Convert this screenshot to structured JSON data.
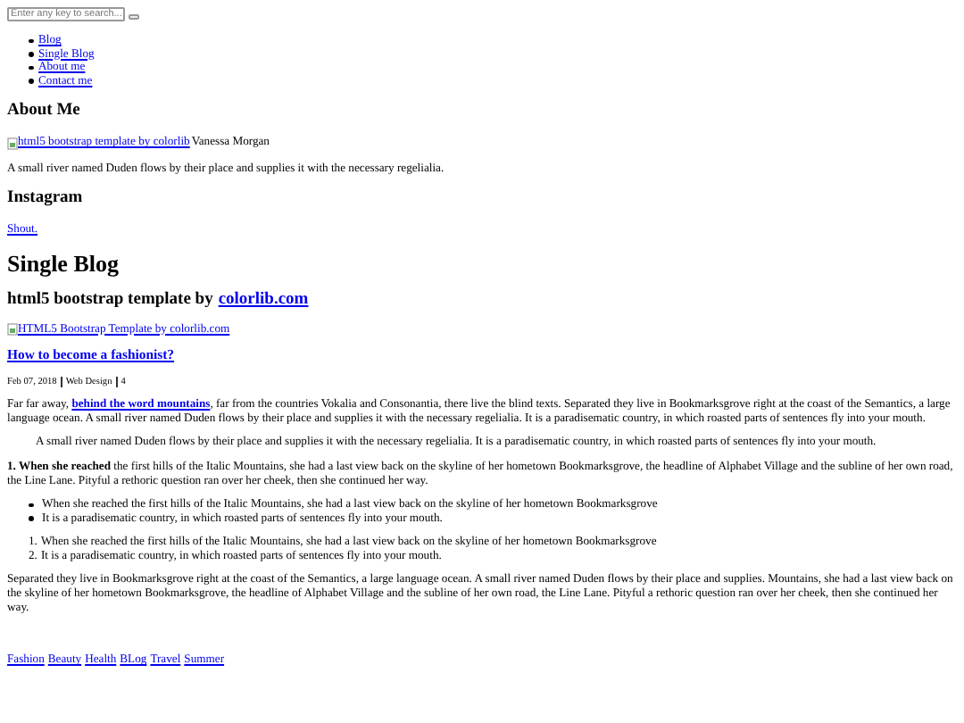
{
  "search": {
    "placeholder": "Enter any key to search..."
  },
  "nav": {
    "items": [
      "Blog",
      "Single Blog",
      "About me",
      "Contact me"
    ]
  },
  "about": {
    "title": "About Me",
    "image_alt": "html5 bootstrap template by colorlib",
    "author": "Vanessa Morgan",
    "text": "A small river named Duden flows by their place and supplies it with the necessary regelialia."
  },
  "instagram": {
    "title": "Instagram",
    "link": "Shout."
  },
  "page_title": "Single Blog",
  "subtitle": {
    "text": "html5 bootstrap template by",
    "link": "colorlib.com"
  },
  "post": {
    "image_alt": "HTML5 Bootstrap Template by colorlib.com",
    "title": "How to become a fashionist?",
    "meta": [
      "Feb 07, 2018",
      "Web Design",
      "4"
    ],
    "intro": {
      "before": "Far far away,",
      "link": "behind the word mountains",
      "after": ", far from the countries Vokalia and Consonantia, there live the blind texts. Separated they live in Bookmarksgrove right at the coast of the Semantics, a large language ocean. A small river named Duden flows by their place and supplies it with the necessary regelialia. It is a paradisematic country, in which roasted parts of sentences fly into your mouth."
    },
    "quote": "A small river named Duden flows by their place and supplies it with the necessary regelialia. It is a paradisematic country, in which roasted parts of sentences fly into your mouth.",
    "numbered": "**1. When she reached** the first hills of the Italic Mountains, she had a last view back on the skyline of her hometown Bookmarksgrove, the headline of Alphabet Village and the subline of her own road, the Line Lane. Pityful a rethoric question ran over her cheek, then she continued her way.",
    "bullets": [
      "When she reached the first hills of the Italic Mountains, she had a last view back on the skyline of her hometown Bookmarksgrove",
      "It is a paradisematic country, in which roasted parts of sentences fly into your mouth."
    ],
    "ordered": [
      {
        "number": "1.",
        "text": "When she reached the first hills of the Italic Mountains, she had a last view back on the skyline of her hometown Bookmarksgrove"
      },
      {
        "number": "2.",
        "text": "It is a paradisematic country, in which roasted parts of sentences fly into your mouth."
      }
    ],
    "closing": "Separated they live in Bookmarksgrove right at the coast of the Semantics, a large language ocean. A small river named Duden flows by their place and supplies. Mountains, she had a last view back on the skyline of her hometown Bookmarksgrove, the headline of Alphabet Village and the subline of her own road, the Line Lane. Pityful a rethoric question ran over her cheek, then she continued her way."
  },
  "tags": [
    "Fashion",
    "Beauty",
    "Health",
    "BLog",
    "Travel",
    "Summer"
  ]
}
